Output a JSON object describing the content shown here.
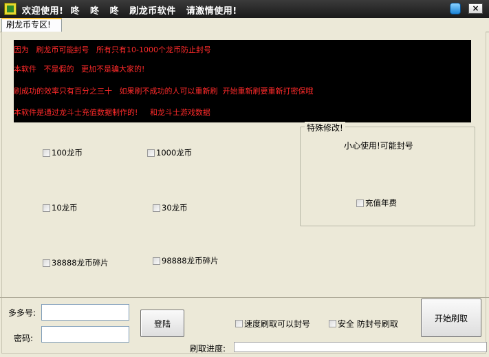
{
  "window": {
    "title": "欢迎使用!  咚   咚   咚   刷龙币软件   请激情使用!",
    "close_label": "×"
  },
  "icons": {
    "app": "app-logo-icon",
    "skin": "skin-shirt-icon",
    "close": "close-icon"
  },
  "tab": {
    "label": "刷龙币专区!"
  },
  "notice": {
    "lines": [
      "因为   刷龙币可能封号   所有只有10-1000个龙币防止封号",
      "本软件   不是假的   更加不是骗大家的!",
      "刷成功的效率只有百分之三十   如果刷不成功的人可以重新刷  开始重新刷要重新打密保哦",
      "本软件是通过龙斗士充值数据制作的!     和龙斗士游戏数据"
    ],
    "text_color": "#ff2a2a"
  },
  "options": {
    "coin_100": "100龙币",
    "coin_1000": "1000龙币",
    "coin_10": "10龙币",
    "coin_30": "30龙币",
    "fragment_38888": "38888龙币碎片",
    "fragment_98888": "98888龙币碎片"
  },
  "special": {
    "title": "特殊修改!",
    "warning": "小心使用!可能封号",
    "annual_fee": "充值年费"
  },
  "login": {
    "account_label": "多多号:",
    "account_value": "",
    "password_label": "密码:",
    "password_value": "",
    "login_button": "登陆"
  },
  "modes": {
    "speed": "速度刷取可以封号",
    "safe": "安全  防封号刷取"
  },
  "actions": {
    "start_button": "开始刷取"
  },
  "progress": {
    "label": "刷取进度:",
    "value": 0
  }
}
